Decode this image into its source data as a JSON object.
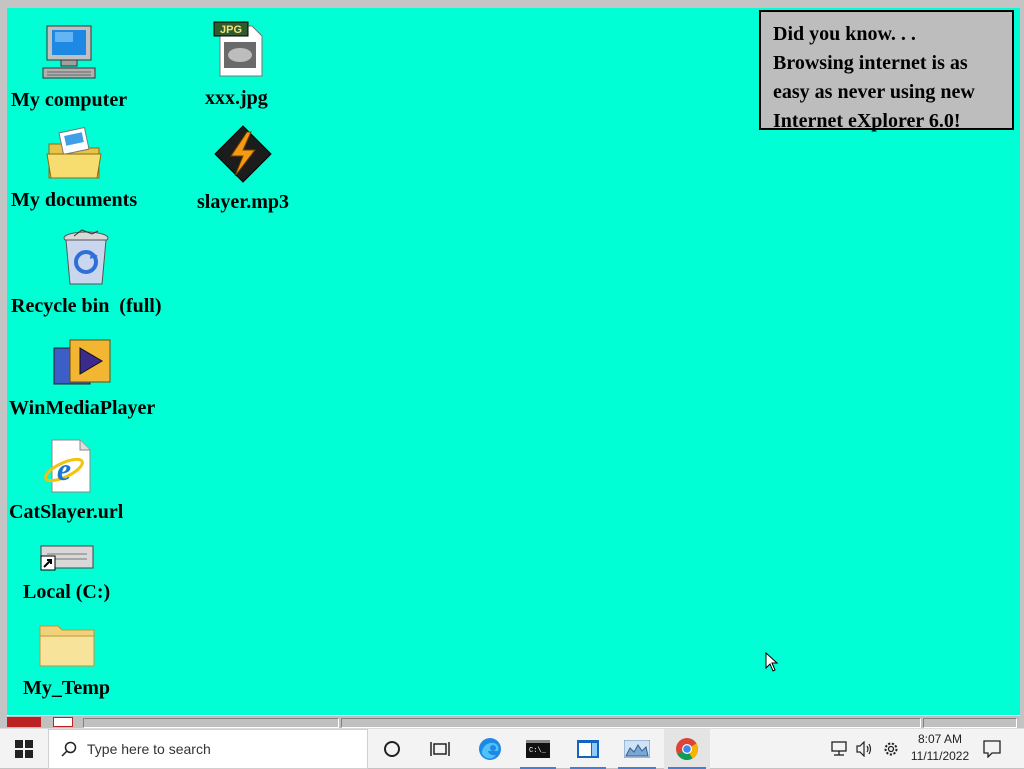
{
  "desktop": {
    "icons": [
      {
        "label": "My computer"
      },
      {
        "label": "My documents"
      },
      {
        "label": "Recycle bin  (full)"
      },
      {
        "label": "WinMediaPlayer"
      },
      {
        "label": "CatSlayer.url"
      },
      {
        "label": "Local (C:)"
      },
      {
        "label": "My_Temp"
      },
      {
        "label": "xxx.jpg",
        "badge": "JPG"
      },
      {
        "label": "slayer.mp3"
      }
    ],
    "tip": {
      "lines": [
        "Did you know. . .",
        "Browsing internet is as",
        "easy as never using new",
        "Internet eXplorer 6.0!"
      ]
    },
    "background_color": "#00ffd5"
  },
  "taskbar": {
    "search_placeholder": "Type here to search",
    "time": "8:07 AM",
    "date": "11/11/2022",
    "accent": "#4a7fcf"
  }
}
